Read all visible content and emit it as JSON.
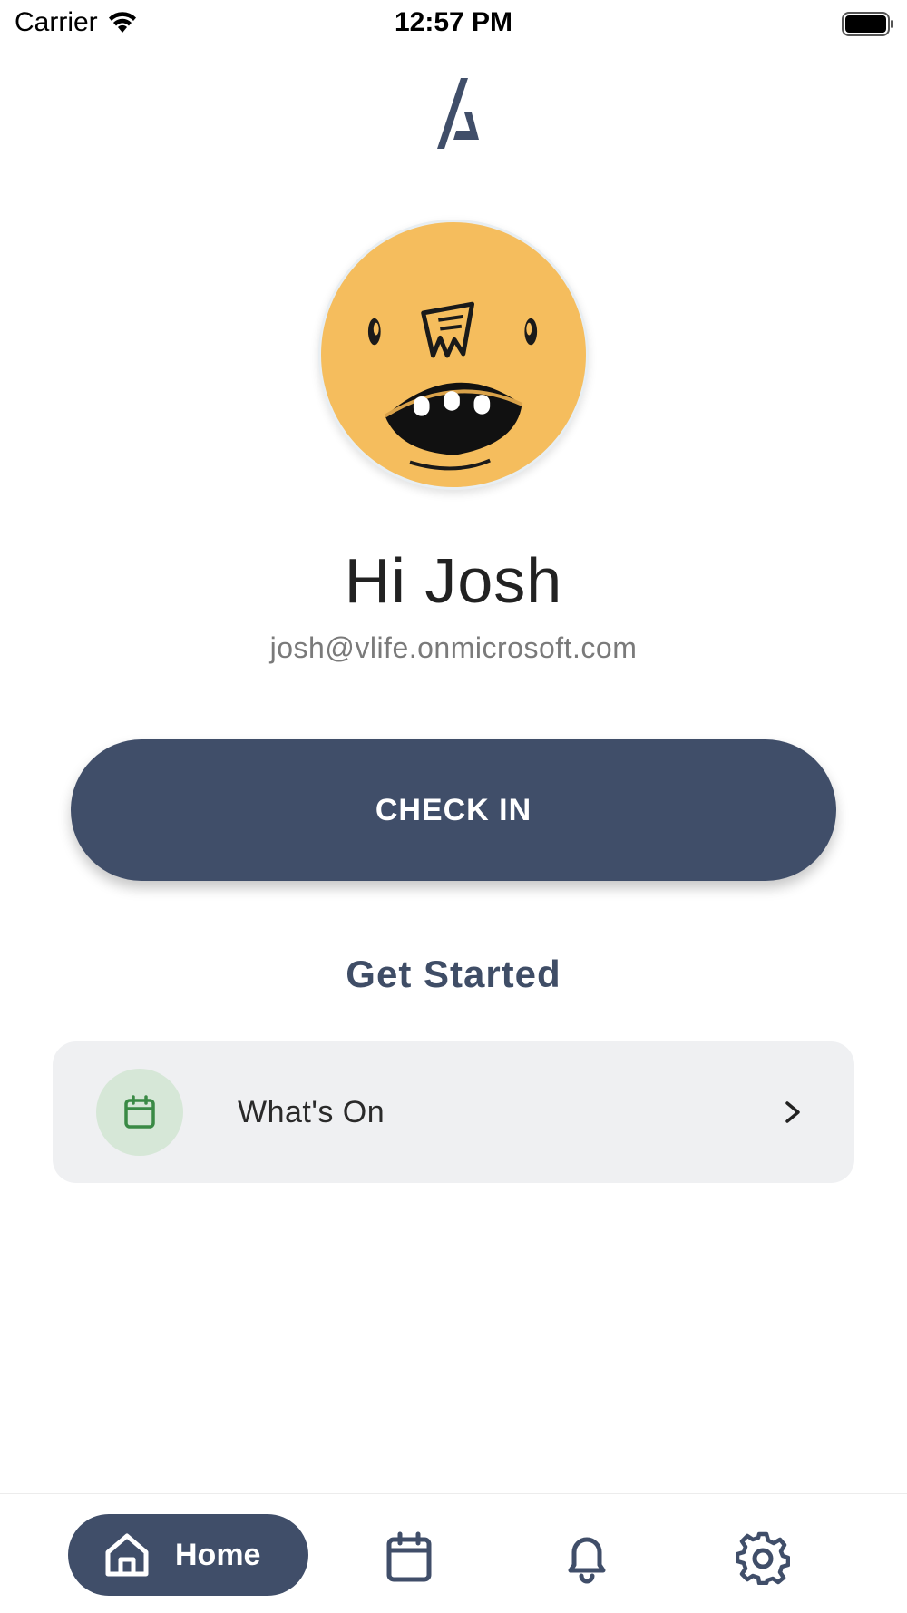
{
  "status_bar": {
    "carrier": "Carrier",
    "time": "12:57 PM",
    "icons": [
      "wifi-icon",
      "battery-icon"
    ]
  },
  "header": {
    "logo": "app-logo"
  },
  "profile": {
    "greeting": "Hi Josh",
    "email": "josh@vlife.onmicrosoft.com",
    "avatar_color": "#f5bd5d"
  },
  "actions": {
    "check_in_label": "CHECK IN"
  },
  "get_started": {
    "title": "Get Started",
    "items": [
      {
        "label": "What's On",
        "icon": "calendar-icon",
        "icon_color": "#3a8a45",
        "chevron": "chevron-right-icon"
      }
    ]
  },
  "tabbar": {
    "tabs": [
      {
        "label": "Home",
        "icon": "home-icon",
        "active": true
      },
      {
        "label": "",
        "icon": "calendar-icon",
        "active": false
      },
      {
        "label": "",
        "icon": "bell-icon",
        "active": false
      },
      {
        "label": "",
        "icon": "gear-icon",
        "active": false
      }
    ]
  },
  "colors": {
    "primary": "#404e69",
    "card_bg": "#eff0f2",
    "accent_green": "#3a8a45"
  }
}
